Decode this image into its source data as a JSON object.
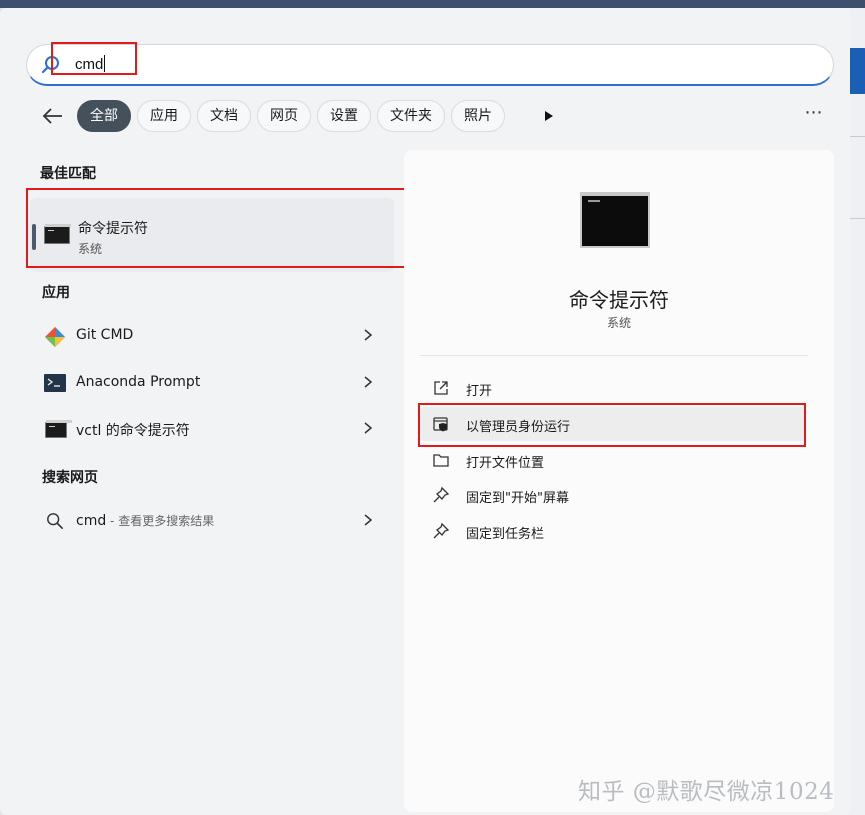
{
  "search": {
    "query": "cmd"
  },
  "filters": [
    "全部",
    "应用",
    "文档",
    "网页",
    "设置",
    "文件夹",
    "照片"
  ],
  "sections": {
    "best_match": "最佳匹配",
    "apps": "应用",
    "web": "搜索网页"
  },
  "best_match": {
    "title": "命令提示符",
    "subtitle": "系统"
  },
  "apps": [
    {
      "label": "Git CMD",
      "icon": "git-icon"
    },
    {
      "label": "Anaconda Prompt",
      "icon": "anaconda-prompt-icon"
    },
    {
      "label": "vctl 的命令提示符",
      "icon": "terminal-icon"
    }
  ],
  "web": {
    "query": "cmd",
    "hint": " - 查看更多搜索结果"
  },
  "detail": {
    "title": "命令提示符",
    "subtitle": "系统",
    "actions": [
      {
        "label": "打开",
        "icon": "open-external-icon"
      },
      {
        "label": "以管理员身份运行",
        "icon": "admin-shield-icon"
      },
      {
        "label": "打开文件位置",
        "icon": "folder-icon"
      },
      {
        "label": "固定到\"开始\"屏幕",
        "icon": "pin-icon"
      },
      {
        "label": "固定到任务栏",
        "icon": "pin-icon"
      }
    ]
  },
  "watermark": "知乎 @默歌尽微凉1024",
  "colors": {
    "accent": "#2f6fd1",
    "active_chip": "#44505c",
    "highlight_box": "#e01b1b"
  }
}
